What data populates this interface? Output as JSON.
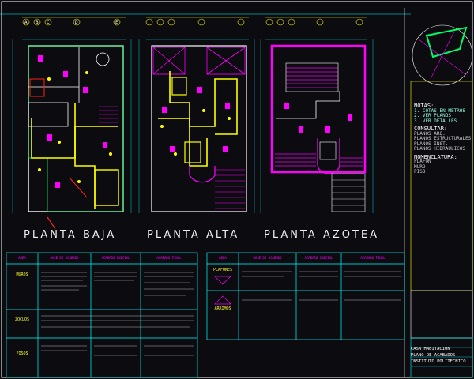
{
  "drawing": {
    "plans": [
      {
        "id": "planta-baja",
        "title": "PLANTA BAJA"
      },
      {
        "id": "planta-alta",
        "title": "PLANTA ALTA"
      },
      {
        "id": "planta-azotea",
        "title": "PLANTA AZOTEA"
      }
    ],
    "axis_labels": [
      "A",
      "B",
      "C",
      "D",
      "E"
    ],
    "row_labels": [
      "1",
      "2",
      "3",
      "4",
      "5",
      "6"
    ],
    "notes": {
      "title": "NOTAS:",
      "lines": [
        "1. COTAS EN METROS",
        "2. VER PLANOS",
        "3. VER DETALLES"
      ],
      "consultar_title": "CONSULTAR:",
      "consultar_lines": [
        "PLANOS ARQ.",
        "PLANOS ESTRUCTURALES",
        "PLANOS INST.",
        "PLANOS HIDRAULICOS"
      ],
      "nomenclatura_title": "NOMENCLATURA:",
      "nomenclatura_lines": [
        "PLAFON",
        "MURO",
        "PISO"
      ]
    },
    "title_block": {
      "project": "CASA HABITACION",
      "sheet": "PLANO DE ACABADOS",
      "institution": "INSTITUTO POLITECNICO"
    },
    "tables": {
      "left_headers": [
        "AREA",
        "BASE DE ACABADO",
        "ACABADO INICIAL",
        "ACABADO FINAL"
      ],
      "left_areas": [
        "MUROS",
        "ZOCLOS",
        "PISOS"
      ],
      "right_headers": [
        "AREA",
        "BASE DE ACABADO",
        "ACABADO INICIAL",
        "ACABADO FINAL"
      ],
      "right_areas": [
        "PLAFONES",
        "ARRIMOS"
      ]
    },
    "colors": {
      "bg": "#0b0b10",
      "magenta": "#ff00ff",
      "yellow": "#ffff00",
      "cyan": "#00ffff",
      "red": "#ff2020",
      "green": "#00ff66",
      "white": "#ffffff"
    }
  }
}
